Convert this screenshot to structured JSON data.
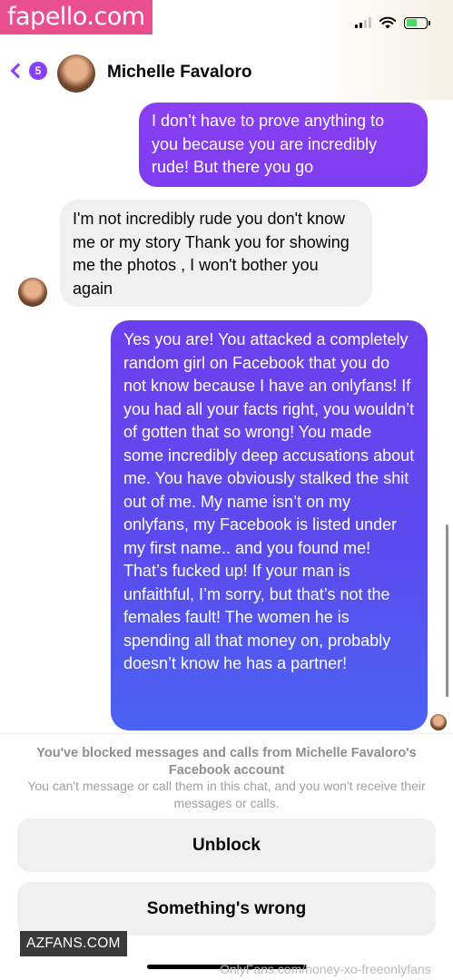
{
  "watermark_top": "fapello.com",
  "watermark_bottom_left": "AZFANS.COM",
  "watermark_bottom_right": "OnlyFans.com/honey-xo-freeonlyfans",
  "header": {
    "back_badge_count": "5",
    "contact_name": "Michelle Favaloro",
    "accent_color": "#8a3ffc"
  },
  "messages": [
    {
      "direction": "outgoing",
      "text": "I don’t have to prove anything to you because you are incredibly rude! But there you go"
    },
    {
      "direction": "incoming",
      "text": "I'm not incredibly rude you don't know me or my story Thank you for showing me the photos , I won't bother you again"
    },
    {
      "direction": "outgoing",
      "text": "Yes you are! You attacked a completely random girl on Facebook that you do not know because I have an onlyfans! If you had all your facts right, you wouldn’t of gotten that so wrong! You made some incredibly deep accusations about me. You have obviously stalked the shit out of me. My name isn’t on my onlyfans, my Facebook is listed under my first name.. and you found me! That’s fucked up! If your man is unfaithful, I’m sorry, but that’s not the females fault! The women he is spending all that money on, probably doesn’t know he has a partner!"
    }
  ],
  "block_notice": {
    "title": "You've blocked messages and calls from Michelle Favaloro's Facebook account",
    "subtitle": "You can't message or call them in this chat, and you won't receive their messages or calls.",
    "unblock_label": "Unblock",
    "wrong_label": "Something's wrong"
  }
}
